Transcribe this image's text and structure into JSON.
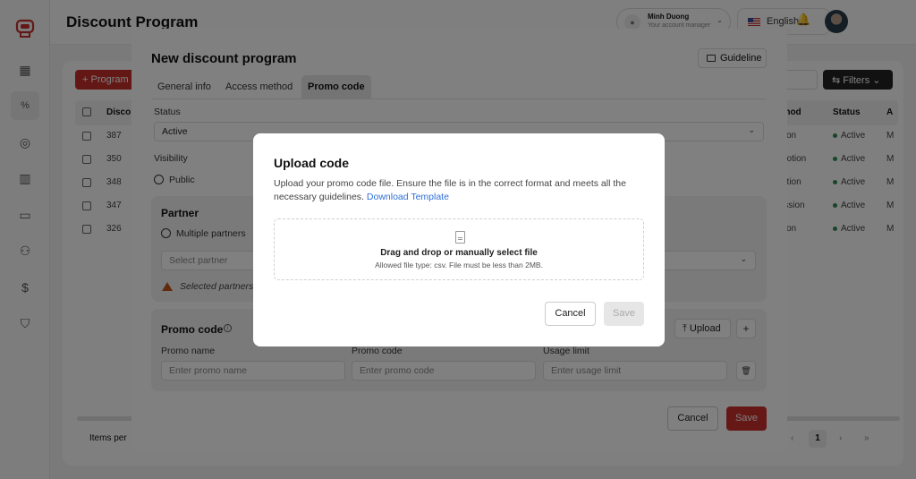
{
  "app": {
    "page_title": "Discount Program",
    "user": {
      "name": "Minh Duong",
      "role": "Your account manager"
    },
    "language": "English",
    "sidebar": {
      "items": [
        {
          "icon": "dashboard-icon",
          "glyph": "▦"
        },
        {
          "icon": "discount-document-icon",
          "glyph": "🗎"
        },
        {
          "icon": "compass-icon",
          "glyph": "◎"
        },
        {
          "icon": "report-chart-icon",
          "glyph": "▥"
        },
        {
          "icon": "briefcase-icon",
          "glyph": "▭"
        },
        {
          "icon": "users-icon",
          "glyph": "⚇"
        },
        {
          "icon": "invoice-dollar-icon",
          "glyph": "$"
        },
        {
          "icon": "shield-icon",
          "glyph": "⛉"
        }
      ]
    },
    "toolbar": {
      "add_program_label": "+ Program",
      "filters_label": "⇆ Filters ⌄"
    },
    "table": {
      "headers": {
        "discount": "Disco",
        "method": "thod",
        "status": "Status",
        "extra": "A"
      },
      "rows": [
        {
          "id": "387",
          "method": "tion",
          "status": "Active",
          "extra": "M"
        },
        {
          "id": "350",
          "method": "notion",
          "status": "Active",
          "extra": "M"
        },
        {
          "id": "348",
          "method": "otion",
          "status": "Active",
          "extra": "M"
        },
        {
          "id": "347",
          "method": "ission",
          "status": "Active",
          "extra": "M"
        },
        {
          "id": "326",
          "method": "tion",
          "status": "Active",
          "extra": "M"
        }
      ],
      "items_per_page_label": "Items per",
      "pagination": {
        "prev": "‹",
        "current": "1",
        "next": "›",
        "last": "»"
      }
    }
  },
  "drawer": {
    "title": "New discount program",
    "guideline_label": "Guideline",
    "tabs": [
      {
        "label": "General info",
        "active": false
      },
      {
        "label": "Access method",
        "active": false
      },
      {
        "label": "Promo code",
        "active": true
      }
    ],
    "status": {
      "label": "Status",
      "value": "Active"
    },
    "visibility": {
      "label": "Visibility",
      "option": "Public"
    },
    "partner": {
      "title": "Partner",
      "option": "Multiple partners",
      "select_placeholder": "Select partner",
      "warning": "Selected partners"
    },
    "promo_code": {
      "title": "Promo code",
      "upload_label": "Upload",
      "add_label": "+",
      "fields": {
        "name": {
          "label": "Promo name",
          "placeholder": "Enter promo name"
        },
        "code": {
          "label": "Promo code",
          "placeholder": "Enter promo code"
        },
        "limit": {
          "label": "Usage limit",
          "placeholder": "Enter usage limit"
        }
      }
    },
    "cancel_label": "Cancel",
    "save_label": "Save"
  },
  "upload_dialog": {
    "title": "Upload code",
    "description": "Upload your promo code file. Ensure the file is in the correct format and meets all the necessary guidelines.",
    "download_link": "Download Template",
    "dropzone_title": "Drag and drop or manually select file",
    "dropzone_hint": "Allowed file type: csv. File must be less than 2MB.",
    "cancel_label": "Cancel",
    "save_label": "Save"
  },
  "colors": {
    "brand": "#c9302c",
    "link": "#2f6fd8",
    "status_active": "#2e8b57",
    "warning": "#c2571a"
  }
}
